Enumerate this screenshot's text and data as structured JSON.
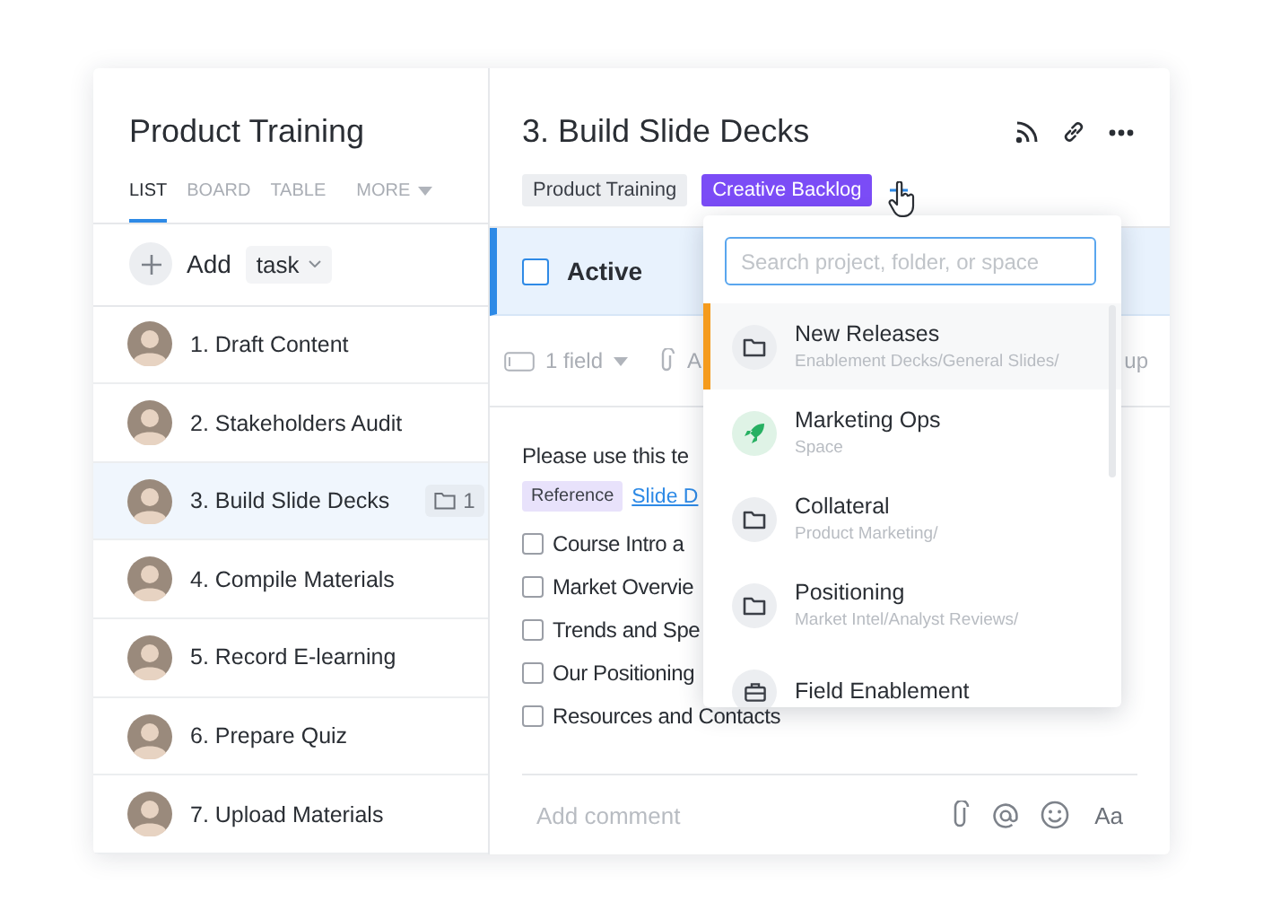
{
  "list_panel": {
    "title": "Product Training",
    "tabs": [
      {
        "label": "LIST",
        "selected": true
      },
      {
        "label": "BOARD",
        "selected": false
      },
      {
        "label": "TABLE",
        "selected": false
      },
      {
        "label": "MORE",
        "selected": false,
        "kind": "menu"
      }
    ],
    "add_row": {
      "label": "Add",
      "type": "task"
    },
    "tasks": [
      {
        "title": "1. Draft Content",
        "selected": false
      },
      {
        "title": "2. Stakeholders Audit",
        "selected": false
      },
      {
        "title": "3. Build Slide Decks",
        "selected": true,
        "folder_count": "1"
      },
      {
        "title": "4. Compile Materials",
        "selected": false
      },
      {
        "title": "5. Record E-learning",
        "selected": false
      },
      {
        "title": "6. Prepare Quiz",
        "selected": false
      },
      {
        "title": "7. Upload Materials",
        "selected": false
      }
    ]
  },
  "task_detail": {
    "title": "3. Build Slide Decks",
    "tags": [
      {
        "label": "Product Training",
        "kind": "plain"
      },
      {
        "label": "Creative Backlog",
        "kind": "highlight"
      }
    ],
    "status": {
      "label": "Active",
      "checked": false
    },
    "toolbar": {
      "fields": "1 field",
      "attach": "A",
      "right": "up"
    },
    "description": "Please use this te",
    "reference": {
      "tag": "Reference",
      "link": "Slide D"
    },
    "checklist": [
      {
        "text": "Course Intro a",
        "checked": false
      },
      {
        "text": "Market Overvie",
        "checked": false
      },
      {
        "text": "Trends and Spe",
        "checked": false
      },
      {
        "text": "Our Positioning",
        "checked": false
      },
      {
        "text": "Resources and Contacts",
        "checked": false
      }
    ],
    "comment": {
      "placeholder": "Add comment"
    },
    "format_button": "Aa"
  },
  "location_menu": {
    "search": {
      "placeholder": "Search project, folder, or space"
    },
    "items": [
      {
        "name": "New Releases",
        "path": "Enablement Decks/General Slides/",
        "kind": "folder",
        "selected": true
      },
      {
        "name": "Marketing Ops",
        "path": "Space",
        "kind": "space",
        "selected": false
      },
      {
        "name": "Collateral",
        "path": "Product Marketing/",
        "kind": "folder",
        "selected": false
      },
      {
        "name": "Positioning",
        "path": "Market Intel/Analyst Reviews/",
        "kind": "folder",
        "selected": false
      },
      {
        "name": "Field Enablement",
        "kind": "stack",
        "selected": false
      }
    ]
  }
}
